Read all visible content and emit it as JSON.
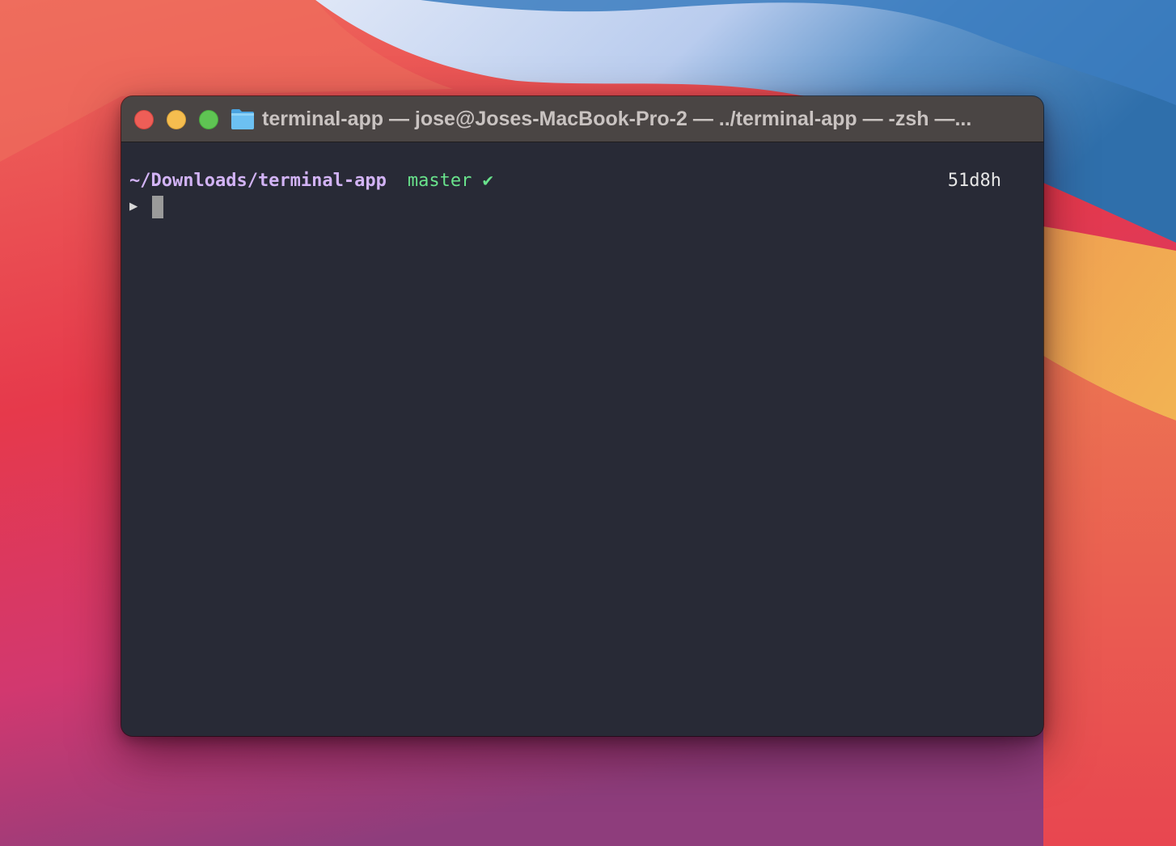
{
  "window": {
    "title": "terminal-app — jose@Joses-MacBook-Pro-2 — ../terminal-app — -zsh —...",
    "controls": {
      "close": "close",
      "minimize": "minimize",
      "zoom": "zoom"
    },
    "title_icon": "folder-icon"
  },
  "terminal": {
    "cwd": "~/Downloads/terminal-app",
    "branch": "master",
    "status_symbol": "✔",
    "elapsed": "51d8h",
    "prompt_symbol": "▶",
    "input": ""
  },
  "colors": {
    "terminal_bg": "#282a36",
    "titlebar_bg": "#4a4544",
    "cwd": "#d2b3f5",
    "branch": "#69e38c",
    "close": "#ee5e57",
    "minimize": "#f5bd4f",
    "zoom": "#5fc453"
  }
}
